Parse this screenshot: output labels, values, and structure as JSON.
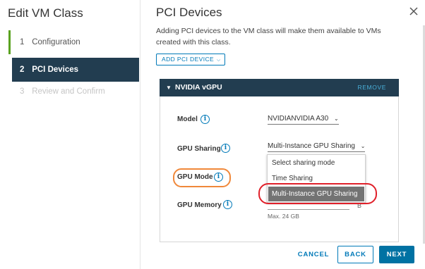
{
  "left": {
    "title": "Edit VM Class",
    "steps": [
      {
        "num": "1",
        "label": "Configuration"
      },
      {
        "num": "2",
        "label": "PCI Devices"
      },
      {
        "num": "3",
        "label": "Review and Confirm"
      }
    ]
  },
  "main": {
    "title": "PCI Devices",
    "description": "Adding PCI devices to the VM class will make them available to VMs created with this class.",
    "add_button": "ADD PCI DEVICE"
  },
  "card": {
    "name": "NVIDIA vGPU",
    "remove": "REMOVE",
    "model_label": "Model",
    "model_value": "NVIDIANVIDIA A30",
    "gpu_sharing_label": "GPU Sharing",
    "gpu_sharing_value": "Multi-Instance GPU Sharing",
    "gpu_mode_label": "GPU Mode",
    "gpu_memory_label": "GPU Memory",
    "gpu_memory_hint": "Max. 24 GB",
    "gpu_memory_suffix": "B",
    "sharing_options": [
      "Select sharing mode",
      "Time Sharing",
      "Multi-Instance GPU Sharing"
    ]
  },
  "footer": {
    "cancel": "CANCEL",
    "back": "BACK",
    "next": "NEXT"
  },
  "colors": {
    "nav_active_bg": "#223d50",
    "accent": "#0079b8",
    "step_done": "#5aa220",
    "annotation_orange": "#f0883a",
    "annotation_red": "#e0202a"
  }
}
